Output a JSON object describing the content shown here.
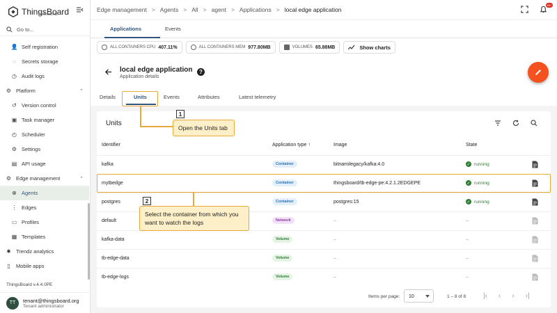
{
  "app": {
    "logo_text": "ThingsBoard",
    "logo_sub": "Professional",
    "goto_placeholder": "Go to...",
    "version": "ThingsBoard v.4.4.0PE"
  },
  "sidebar": {
    "items": [
      {
        "label": "Self registration",
        "icon": "user-plus-icon"
      },
      {
        "label": "Secrets storage",
        "icon": "database-icon"
      },
      {
        "label": "Audit logs",
        "icon": "clock-icon"
      },
      {
        "label": "Platform",
        "icon": "settings-icon",
        "section": true
      },
      {
        "label": "Version control",
        "icon": "history-icon"
      },
      {
        "label": "Task manager",
        "icon": "task-icon"
      },
      {
        "label": "Scheduler",
        "icon": "calendar-icon"
      },
      {
        "label": "Settings",
        "icon": "gear-icon"
      },
      {
        "label": "API usage",
        "icon": "chart-icon"
      },
      {
        "label": "Edge management",
        "icon": "edge-icon",
        "section": true
      },
      {
        "label": "Agents",
        "icon": "agent-icon",
        "active": true
      },
      {
        "label": "Edges",
        "icon": "edges-icon"
      },
      {
        "label": "Profiles",
        "icon": "profile-icon"
      },
      {
        "label": "Templates",
        "icon": "template-icon"
      },
      {
        "label": "Trendz analytics",
        "icon": "trendz-icon",
        "section": true
      },
      {
        "label": "Mobile apps",
        "icon": "mobile-icon",
        "section": true
      }
    ]
  },
  "user": {
    "initials": "TT",
    "name": "tenant@thingsboard.org",
    "role": "Tenant administrator"
  },
  "breadcrumb": [
    "Edge management",
    "Agents",
    "All",
    "agent",
    "Applications",
    "local edge application"
  ],
  "notifications_badge": "99+",
  "main_tabs": [
    "Applications",
    "Events"
  ],
  "stats": [
    {
      "label": "ALL CONTAINERS CPU",
      "value": "407.11%"
    },
    {
      "label": "ALL CONTAINERS MEM",
      "value": "977.80MB"
    },
    {
      "label": "VOLUMES",
      "value": "65.88MB"
    }
  ],
  "show_charts": "Show charts",
  "details": {
    "title": "local edge application",
    "subtitle": "Application details",
    "help": "?",
    "tabs": [
      "Details",
      "Units",
      "Events",
      "Attributes",
      "Latest telemetry"
    ]
  },
  "units": {
    "title": "Units",
    "headers": [
      "Identifier",
      "Application type",
      "Image",
      "State"
    ],
    "sort_arrow": "↑",
    "rows": [
      {
        "id": "kafka",
        "type": "Container",
        "image": "bitnamilegacy/kafka:4.0",
        "state": "running"
      },
      {
        "id": "mytbedge",
        "type": "Container",
        "image": "thingsboard/tb-edge-pe:4.2.1.2EDGEPE",
        "state": "running"
      },
      {
        "id": "postgres",
        "type": "Container",
        "image": "postgres:15",
        "state": "running"
      },
      {
        "id": "default",
        "type": "Network",
        "image": "–",
        "state": "–"
      },
      {
        "id": "kafka-data",
        "type": "Volume",
        "image": "–",
        "state": "–"
      },
      {
        "id": "tb-edge-data",
        "type": "Volume",
        "image": "–",
        "state": "–"
      },
      {
        "id": "tb-edge-logs",
        "type": "Volume",
        "image": "–",
        "state": "–"
      }
    ]
  },
  "pager": {
    "label": "Items per page:",
    "size": "10",
    "range": "1 – 8 of 8"
  },
  "callouts": [
    {
      "num": "1",
      "text": "Open the Units tab"
    },
    {
      "num": "2",
      "text": "Select the container from which you want to watch the logs"
    }
  ],
  "colors": {
    "accent": "#305680",
    "fab": "#f4511e",
    "callout_border": "#e8a93a",
    "callout_bg": "#fdf0c8",
    "container_bg": "#e3f0fb",
    "network_bg": "#f3e1f7",
    "volume_bg": "#e6f4e6",
    "running": "#2e7d32"
  }
}
